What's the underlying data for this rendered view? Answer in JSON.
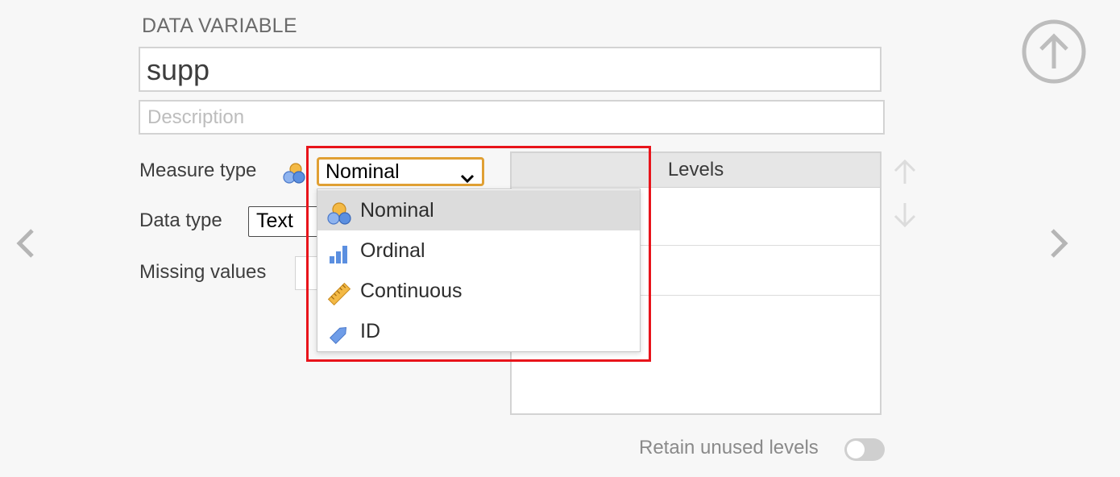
{
  "section": {
    "title": "DATA VARIABLE"
  },
  "variable": {
    "name": "supp",
    "description_placeholder": "Description"
  },
  "measure_type": {
    "label": "Measure type",
    "value": "Nominal",
    "icon": "nominal-icon"
  },
  "data_type": {
    "label": "Data type",
    "value": "Text"
  },
  "missing_values": {
    "label": "Missing values"
  },
  "levels": {
    "header": "Levels",
    "retain_label": "Retain unused levels",
    "retain_on": false
  },
  "dropdown": {
    "options": [
      {
        "label": "Nominal",
        "icon": "nominal-icon",
        "selected": true
      },
      {
        "label": "Ordinal",
        "icon": "ordinal-icon",
        "selected": false
      },
      {
        "label": "Continuous",
        "icon": "continuous-ruler-icon",
        "selected": false
      },
      {
        "label": "ID",
        "icon": "id-tag-icon",
        "selected": false
      }
    ]
  },
  "colors": {
    "accent": "#e0a034",
    "highlight": "#e8141b",
    "nominal_orange": "#f3b945",
    "nominal_blue": "#5b8fe0"
  }
}
